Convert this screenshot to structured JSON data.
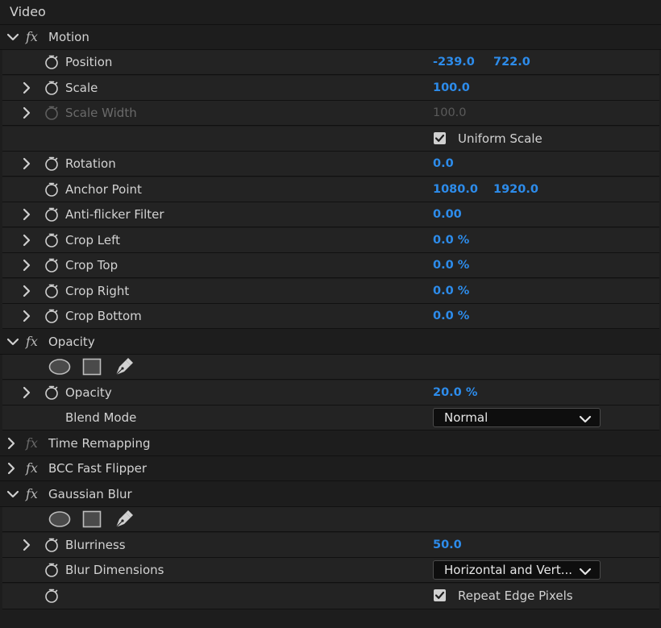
{
  "panel": {
    "title": "Video"
  },
  "motion": {
    "name": "Motion",
    "position": {
      "label": "Position",
      "x": "-239.0",
      "y": "722.0"
    },
    "scale": {
      "label": "Scale",
      "value": "100.0"
    },
    "scale_width": {
      "label": "Scale Width",
      "value": "100.0"
    },
    "uniform_scale": {
      "label": "Uniform Scale",
      "checked": true
    },
    "rotation": {
      "label": "Rotation",
      "value": "0.0"
    },
    "anchor_point": {
      "label": "Anchor Point",
      "x": "1080.0",
      "y": "1920.0"
    },
    "anti_flicker": {
      "label": "Anti-flicker Filter",
      "value": "0.00"
    },
    "crop_left": {
      "label": "Crop Left",
      "value": "0.0 %"
    },
    "crop_top": {
      "label": "Crop Top",
      "value": "0.0 %"
    },
    "crop_right": {
      "label": "Crop Right",
      "value": "0.0 %"
    },
    "crop_bottom": {
      "label": "Crop Bottom",
      "value": "0.0 %"
    }
  },
  "opacity": {
    "name": "Opacity",
    "opacity": {
      "label": "Opacity",
      "value": "20.0 %"
    },
    "blend_mode": {
      "label": "Blend Mode",
      "value": "Normal"
    }
  },
  "time_remapping": {
    "name": "Time Remapping"
  },
  "bcc_fast_flipper": {
    "name": "BCC Fast Flipper"
  },
  "gaussian_blur": {
    "name": "Gaussian Blur",
    "blurriness": {
      "label": "Blurriness",
      "value": "50.0"
    },
    "blur_dimensions": {
      "label": "Blur Dimensions",
      "value": "Horizontal and Vert..."
    },
    "repeat_edge": {
      "label": "Repeat Edge Pixels",
      "checked": true
    }
  },
  "fx_label": "fx",
  "colors": {
    "value_blue": "#2d8ceb",
    "background": "#1d1d1d",
    "row_background": "#232323"
  }
}
